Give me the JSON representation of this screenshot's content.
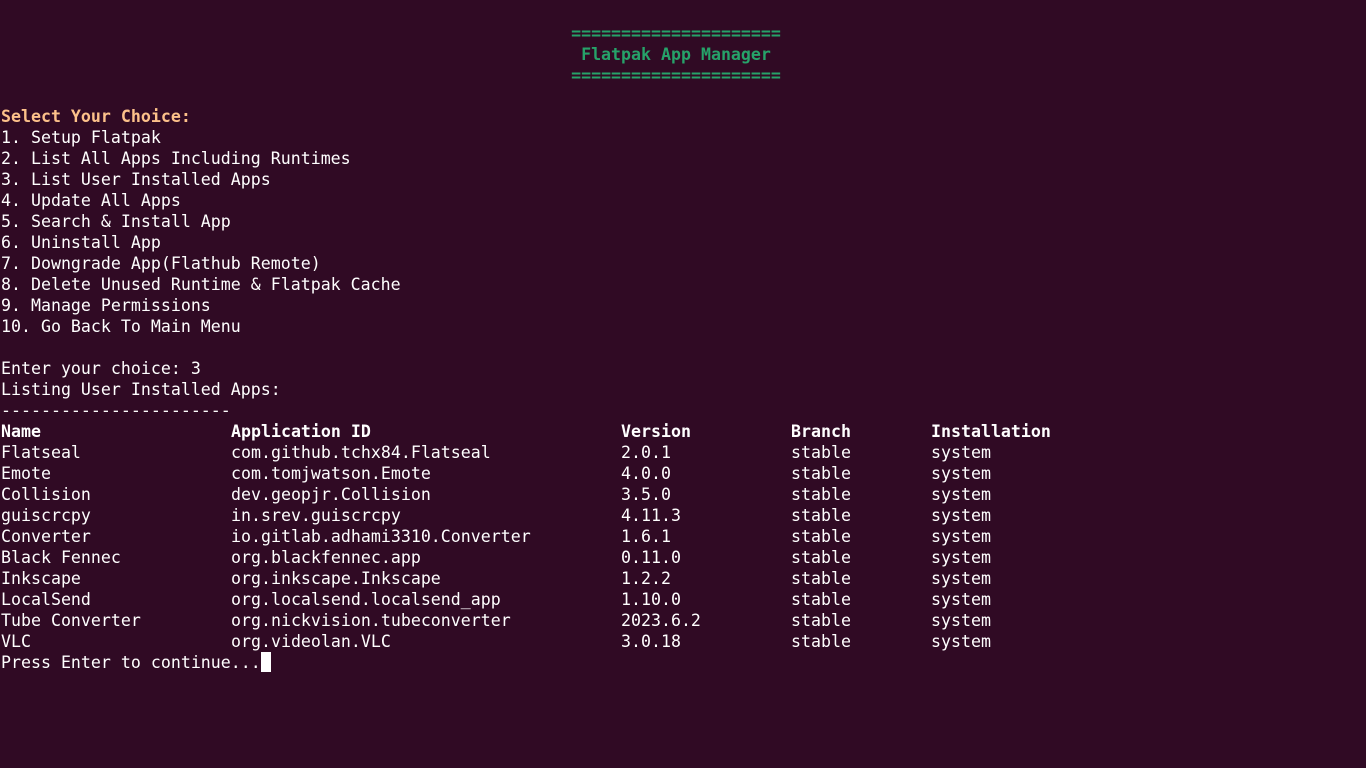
{
  "terminal": {
    "background": "#300a24",
    "foreground": "#ffffff",
    "banner_color": "#26a269",
    "prompt_color": "#fcc18a",
    "banner": {
      "rule_top": "=====================",
      "title": "Flatpak App Manager",
      "rule_bottom": "====================="
    },
    "menu": {
      "heading": "Select Your Choice:",
      "items": [
        "1. Setup Flatpak",
        "2. List All Apps Including Runtimes",
        "3. List User Installed Apps",
        "4. Update All Apps",
        "5. Search & Install App",
        "6. Uninstall App",
        "7. Downgrade App(Flathub Remote)",
        "8. Delete Unused Runtime & Flatpak Cache",
        "9. Manage Permissions",
        "10. Go Back To Main Menu"
      ]
    },
    "input_line": "Enter your choice: 3",
    "listing_heading": "Listing User Installed Apps:",
    "separator": "-----------------------",
    "table": {
      "headers": [
        "Name",
        "Application ID",
        "Version",
        "Branch",
        "Installation"
      ],
      "rows": [
        [
          "Flatseal",
          "com.github.tchx84.Flatseal",
          "2.0.1",
          "stable",
          "system"
        ],
        [
          "Emote",
          "com.tomjwatson.Emote",
          "4.0.0",
          "stable",
          "system"
        ],
        [
          "Collision",
          "dev.geopjr.Collision",
          "3.5.0",
          "stable",
          "system"
        ],
        [
          "guiscrcpy",
          "in.srev.guiscrcpy",
          "4.11.3",
          "stable",
          "system"
        ],
        [
          "Converter",
          "io.gitlab.adhami3310.Converter",
          "1.6.1",
          "stable",
          "system"
        ],
        [
          "Black Fennec",
          "org.blackfennec.app",
          "0.11.0",
          "stable",
          "system"
        ],
        [
          "Inkscape",
          "org.inkscape.Inkscape",
          "1.2.2",
          "stable",
          "system"
        ],
        [
          "LocalSend",
          "org.localsend.localsend_app",
          "1.10.0",
          "stable",
          "system"
        ],
        [
          "Tube Converter",
          "org.nickvision.tubeconverter",
          "2023.6.2",
          "stable",
          "system"
        ],
        [
          "VLC",
          "org.videolan.VLC",
          "3.0.18",
          "stable",
          "system"
        ]
      ]
    },
    "continue_prompt": "Press Enter to continue..."
  }
}
